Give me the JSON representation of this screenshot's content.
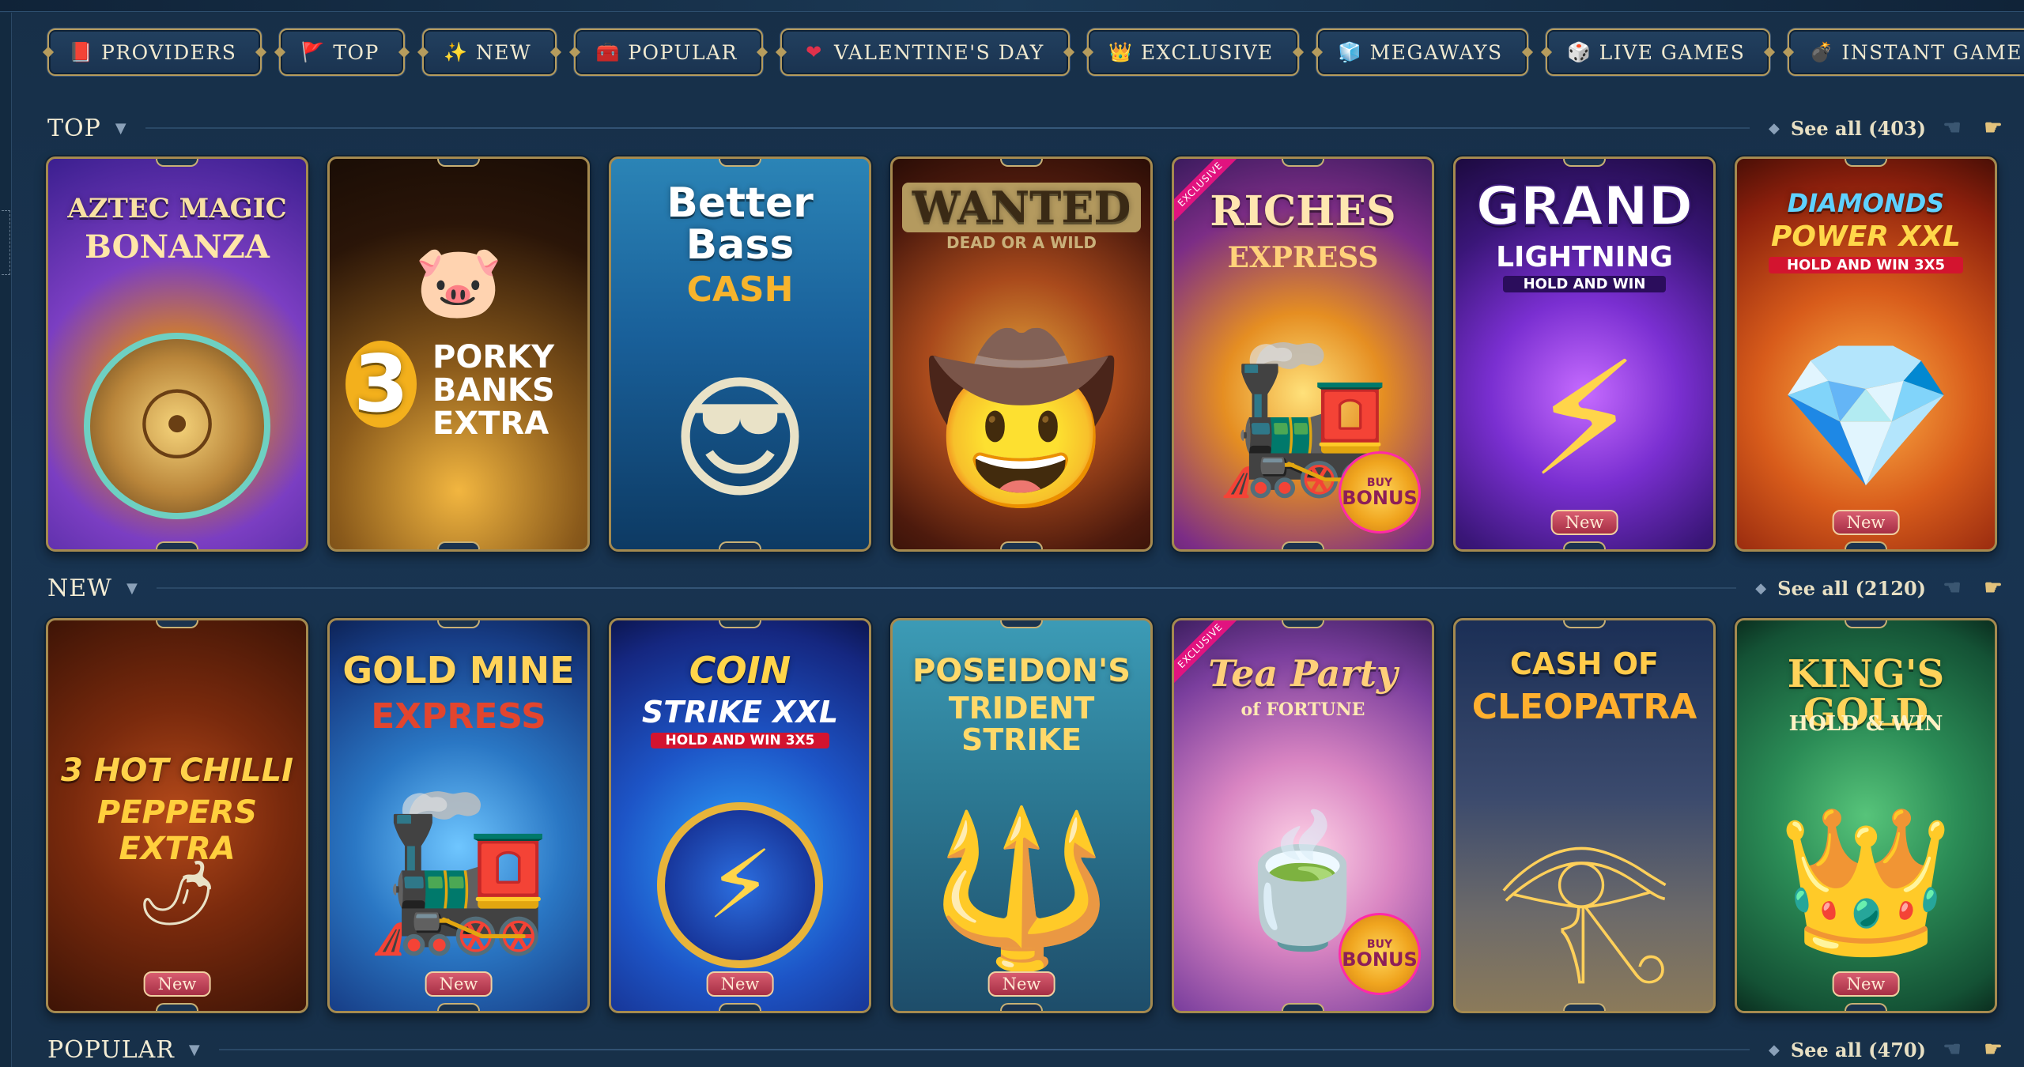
{
  "nav": {
    "categories": [
      {
        "label": "PROVIDERS",
        "icon": "book-icon",
        "glyph": "📕"
      },
      {
        "label": "TOP",
        "icon": "flag-icon",
        "glyph": "🚩"
      },
      {
        "label": "NEW",
        "icon": "sparkle-icon",
        "glyph": "✨"
      },
      {
        "label": "POPULAR",
        "icon": "chest-icon",
        "glyph": "🧰"
      },
      {
        "label": "VALENTINE'S DAY",
        "icon": "heart-icon",
        "glyph": "❤"
      },
      {
        "label": "EXCLUSIVE",
        "icon": "crown-icon",
        "glyph": "👑"
      },
      {
        "label": "MEGAWAYS",
        "icon": "cube-icon",
        "glyph": "🧊"
      },
      {
        "label": "LIVE GAMES",
        "icon": "dealer-icon",
        "glyph": "🎲"
      },
      {
        "label": "INSTANT GAMES",
        "icon": "bomb-icon",
        "glyph": "💣"
      }
    ]
  },
  "sections": {
    "top": {
      "title": "TOP",
      "see_all": "See all (403)"
    },
    "new": {
      "title": "NEW",
      "see_all": "See all (2120)"
    },
    "popular": {
      "title": "POPULAR",
      "see_all": "See all (470)"
    }
  },
  "badges": {
    "new": "New",
    "exclusive": "EXCLUSIVE",
    "buy": "BUY",
    "bonus": "BONUS"
  },
  "top_games": [
    {
      "title": "AZTEC MAGIC",
      "subtitle": "BONANZA",
      "focal": "☉"
    },
    {
      "title": "3",
      "subtitle": "PORKY BANKS EXTRA",
      "focal": "🐷"
    },
    {
      "title": "Better Bass",
      "subtitle": "CASH",
      "focal": "😎"
    },
    {
      "title": "WANTED",
      "subtitle": "DEAD OR A WILD",
      "focal": "🤠"
    },
    {
      "title": "RICHES",
      "subtitle": "EXPRESS",
      "focal": "🚂"
    },
    {
      "title": "GRAND",
      "subtitle": "LIGHTNING",
      "subtitle2": "HOLD AND WIN",
      "focal": "⚡"
    },
    {
      "title": "DIAMONDS",
      "subtitle": "POWER XXL",
      "subtitle2": "HOLD AND WIN 3X5",
      "focal": "💎"
    }
  ],
  "new_games": [
    {
      "title": "3 HOT CHILLI",
      "subtitle": "PEPPERS EXTRA",
      "focal": "🌶"
    },
    {
      "title": "GOLD MINE",
      "subtitle": "EXPRESS",
      "focal": "🚂"
    },
    {
      "title": "COIN",
      "subtitle": "STRIKE XXL",
      "subtitle2": "HOLD AND WIN 3X5",
      "focal": "⚡"
    },
    {
      "title": "POSEIDON'S",
      "subtitle": "TRIDENT STRIKE",
      "focal": "🔱"
    },
    {
      "title": "Tea Party",
      "subtitle": "of FORTUNE",
      "focal": "🍵"
    },
    {
      "title": "CASH OF",
      "subtitle": "CLEOPATRA",
      "focal": "𓂀"
    },
    {
      "title": "KING'S GOLD",
      "subtitle": "HOLD & WIN",
      "focal": "👑"
    }
  ],
  "colors": {
    "gold_border": "#a58a4f",
    "page_bg": "#173049",
    "badge_new": "#c44559",
    "exclusive_ribbon": "#e1137f"
  }
}
